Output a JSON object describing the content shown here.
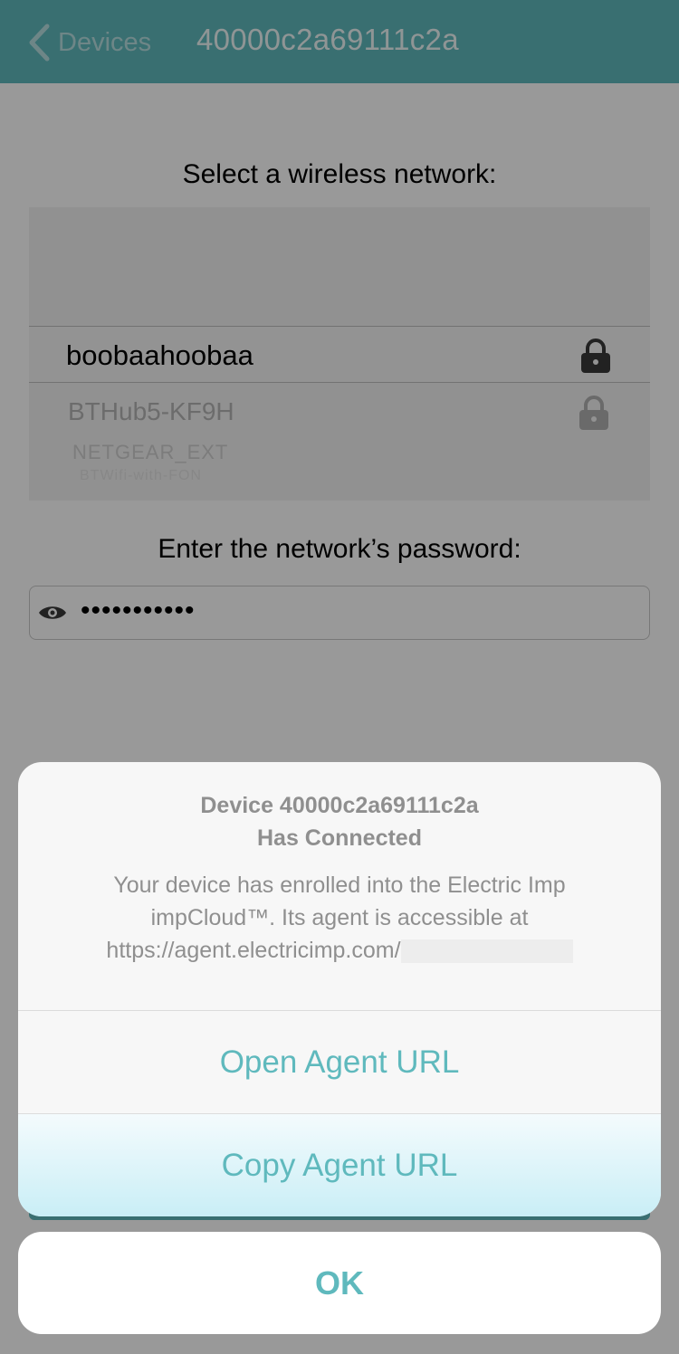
{
  "colors": {
    "accent": "#5fb9bd",
    "overlay": "rgba(0,0,0,0.40)"
  },
  "navbar": {
    "back_label": "Devices",
    "back_icon": "chevron-left-icon",
    "title": "40000c2a69111c2a"
  },
  "form": {
    "network_heading": "Select a wireless network:",
    "networks": [
      {
        "name": "boobaahoobaa",
        "secured": true,
        "selected": true
      },
      {
        "name": "BTHub5-KF9H",
        "secured": true
      },
      {
        "name": "NETGEAR_EXT",
        "secured": false
      },
      {
        "name": "BTWifi-with-FON",
        "secured": false
      }
    ],
    "password_heading": "Enter the network’s password:",
    "password_value": "•••••••••••",
    "eye_icon": "eye-icon"
  },
  "alert": {
    "title_line1": "Device 40000c2a69111c2a",
    "title_line2": "Has Connected",
    "message_line1": "Your device has enrolled into the Electric Imp",
    "message_line2": "impCloud™. Its agent is accessible at",
    "message_line3": "https://agent.electricimp.com/",
    "open_label": "Open Agent URL",
    "copy_label": "Copy Agent URL",
    "ok_label": "OK"
  }
}
